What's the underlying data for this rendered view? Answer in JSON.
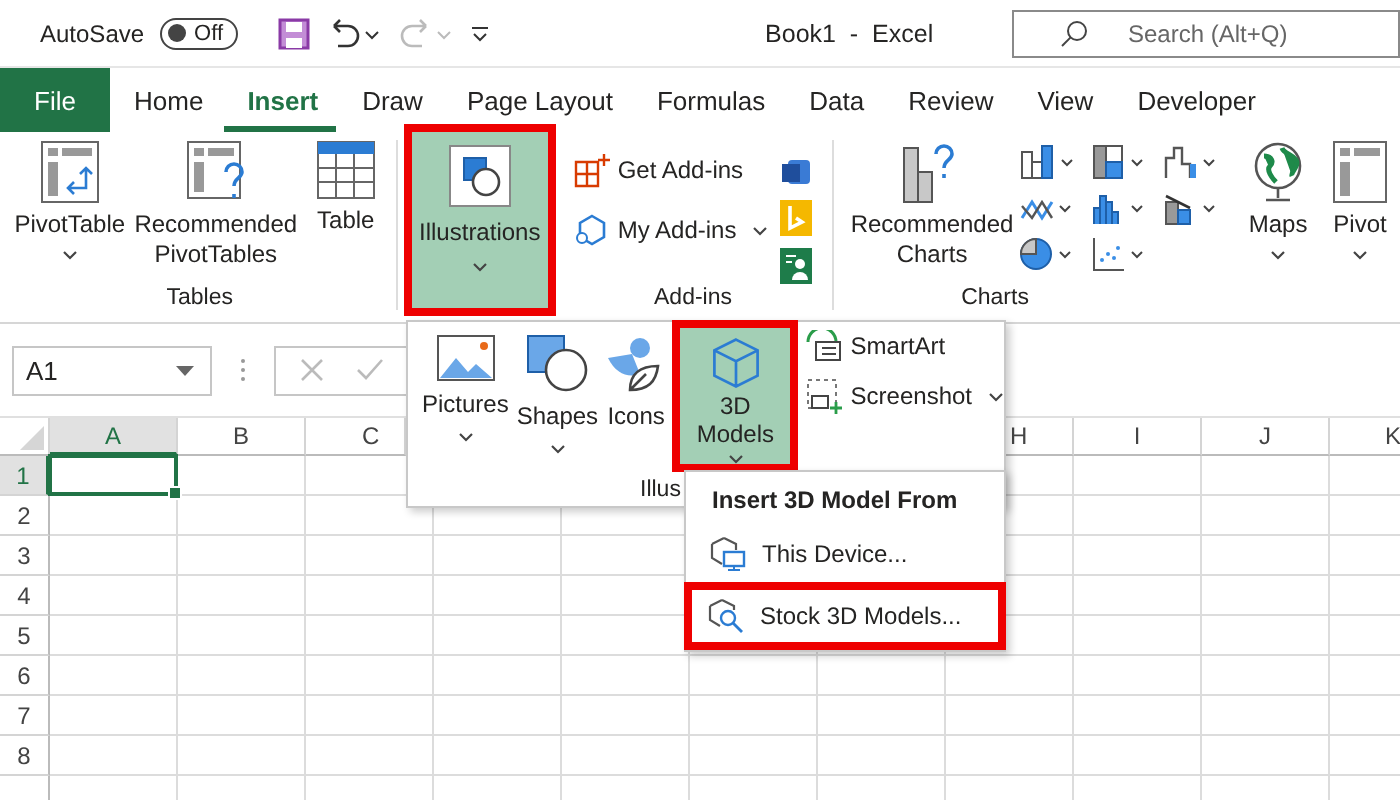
{
  "title_bar": {
    "autosave_label": "AutoSave",
    "autosave_toggle": {
      "label": "Off",
      "on": false
    },
    "document_title": "Book1  -  Excel",
    "search": {
      "placeholder": "Search (Alt+Q)"
    }
  },
  "tabs": [
    {
      "label": "File",
      "kind": "file",
      "selected": false
    },
    {
      "label": "Home",
      "kind": "tab",
      "selected": false
    },
    {
      "label": "Insert",
      "kind": "tab",
      "selected": true
    },
    {
      "label": "Draw",
      "kind": "tab",
      "selected": false
    },
    {
      "label": "Page Layout",
      "kind": "tab",
      "selected": false
    },
    {
      "label": "Formulas",
      "kind": "tab",
      "selected": false
    },
    {
      "label": "Data",
      "kind": "tab",
      "selected": false
    },
    {
      "label": "Review",
      "kind": "tab",
      "selected": false
    },
    {
      "label": "View",
      "kind": "tab",
      "selected": false
    },
    {
      "label": "Developer",
      "kind": "tab",
      "selected": false
    }
  ],
  "ribbon": {
    "tables": {
      "label": "Tables",
      "buttons": [
        {
          "label": "PivotTable",
          "dropdown": true
        },
        {
          "label": "Recommended PivotTables",
          "dropdown": false
        },
        {
          "label": "Table",
          "dropdown": false
        }
      ]
    },
    "illustrations_button": {
      "label": "Illustrations",
      "dropdown": true,
      "highlighted": true
    },
    "addins": {
      "label": "Add-ins",
      "buttons": [
        {
          "label": "Get Add-ins",
          "dropdown": false
        },
        {
          "label": "My Add-ins",
          "dropdown": true
        }
      ]
    },
    "charts": {
      "label": "Charts",
      "buttons": [
        {
          "label": "Recommended Charts",
          "dropdown": false
        },
        {
          "label": "Maps",
          "dropdown": true
        },
        {
          "label": "Pivot",
          "dropdown": true
        }
      ]
    }
  },
  "formula_bar": {
    "name_box": "A1"
  },
  "grid": {
    "columns": [
      {
        "label": "A",
        "selected": true
      },
      {
        "label": "B",
        "selected": false
      },
      {
        "label": "C",
        "selected": false
      },
      {
        "label": "H",
        "selected": false
      },
      {
        "label": "I",
        "selected": false
      },
      {
        "label": "J",
        "selected": false
      },
      {
        "label": "K",
        "selected": false
      }
    ],
    "rows": [
      {
        "label": "1",
        "selected": true
      },
      {
        "label": "2",
        "selected": false
      },
      {
        "label": "3",
        "selected": false
      },
      {
        "label": "4",
        "selected": false
      },
      {
        "label": "5",
        "selected": false
      },
      {
        "label": "6",
        "selected": false
      },
      {
        "label": "7",
        "selected": false
      },
      {
        "label": "8",
        "selected": false
      }
    ]
  },
  "illustrations_panel": {
    "buttons": [
      {
        "label": "Pictures",
        "dropdown": true,
        "highlighted": false
      },
      {
        "label": "Shapes",
        "dropdown": true,
        "highlighted": false
      },
      {
        "label": "Icons",
        "dropdown": false,
        "highlighted": false
      },
      {
        "label": "3D Models",
        "dropdown": true,
        "highlighted": true
      }
    ],
    "side_buttons": [
      {
        "label": "SmartArt",
        "dropdown": false
      },
      {
        "label": "Screenshot",
        "dropdown": true
      }
    ],
    "group_label": "Illus"
  },
  "models_menu": {
    "title": "Insert 3D Model From",
    "items": [
      {
        "label": "This Device...",
        "highlighted": false
      },
      {
        "label": "Stock 3D Models...",
        "highlighted": true
      }
    ]
  }
}
